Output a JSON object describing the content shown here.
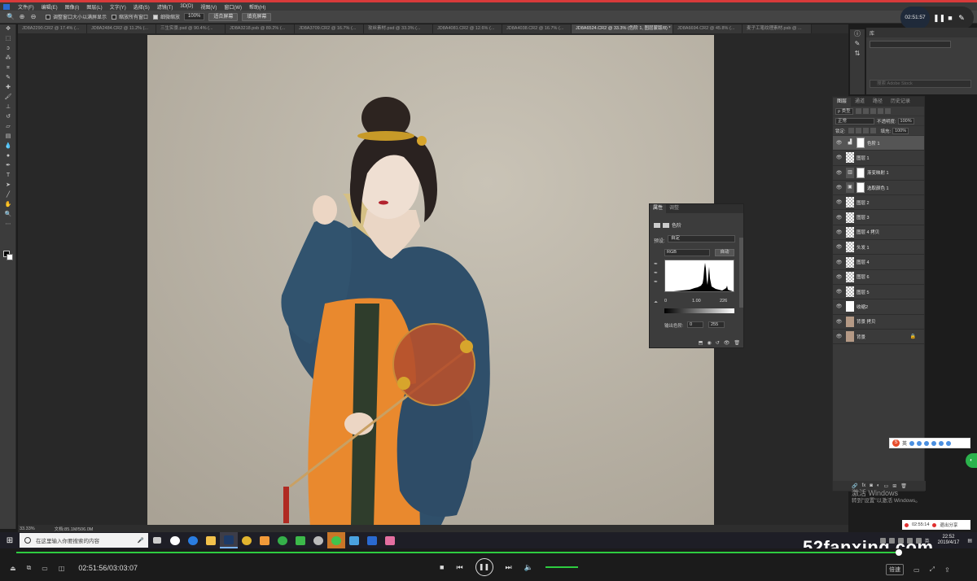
{
  "menubar": {
    "items": [
      "文件(F)",
      "编辑(E)",
      "图像(I)",
      "图层(L)",
      "文字(Y)",
      "选择(S)",
      "滤镜(T)",
      "3D(D)",
      "视图(V)",
      "窗口(W)",
      "帮助(H)"
    ]
  },
  "options": {
    "chk1_label": "调整窗口大小以满屏显示",
    "chk2_label": "缩放所有窗口",
    "chk3_label": "细微缩放",
    "zoom_value": "100%",
    "fit_btn": "适合屏幕",
    "fill_btn": "填充屏幕"
  },
  "tabs": [
    {
      "label": "JD8A2290.CR2 @ 17.4% (..."
    },
    {
      "label": "JD8A2484.CR2 @ 11.2% (..."
    },
    {
      "label": "三生实景.psd @ 90.4% (..."
    },
    {
      "label": "JD8A3218.psb @ 89.2% (..."
    },
    {
      "label": "JD8A3709.CR2 @ 16.7% (..."
    },
    {
      "label": "玫丝素材.psd @ 33.3% (..."
    },
    {
      "label": "JD8A4081.CR2 @ 12.6% (..."
    },
    {
      "label": "JD8A4038.CR2 @ 16.7% (..."
    },
    {
      "label": "JD8A6524.CR2 @ 33.3% (色阶 1, 图层蒙版/8) *"
    },
    {
      "label": "JD8A6694.CR2 @ 45.8% (..."
    },
    {
      "label": "麦子工笔纹理素材.psb @ ..."
    }
  ],
  "status": {
    "zoom": "33.33%",
    "doc": "文档:85.1M/506.0M"
  },
  "recorder": {
    "time": "02:51:57"
  },
  "library": {
    "tab": "库",
    "search_placeholder": "搜索 Adobe Stock"
  },
  "layers_panel": {
    "tabs": [
      "图层",
      "通道",
      "路径",
      "历史记录"
    ],
    "kind": "ρ 类型",
    "blend": "正常",
    "opacity_label": "不透明度:",
    "opacity": "100%",
    "lock_label": "锁定:",
    "fill_label": "填充:",
    "fill": "100%",
    "layers": [
      {
        "name": "色阶 1",
        "thumb": "levels"
      },
      {
        "name": "图层 1",
        "thumb": "transparent"
      },
      {
        "name": "渐变映射 1",
        "thumb": "gradient"
      },
      {
        "name": "选取颜色 1",
        "thumb": "selective"
      },
      {
        "name": "图层 2",
        "thumb": "transparent"
      },
      {
        "name": "图层 3",
        "thumb": "transparent"
      },
      {
        "name": "图层 4 拷贝",
        "thumb": "transparent"
      },
      {
        "name": "头发 1",
        "thumb": "transparent"
      },
      {
        "name": "图层 4",
        "thumb": "transparent"
      },
      {
        "name": "图层 6",
        "thumb": "transparent"
      },
      {
        "name": "图层 5",
        "thumb": "transparent"
      },
      {
        "name": "收缩2",
        "thumb": "white"
      },
      {
        "name": "背景 拷贝",
        "thumb": "photo"
      },
      {
        "name": "背景",
        "thumb": "photo"
      }
    ]
  },
  "properties": {
    "tabs": [
      "属性",
      "调整"
    ],
    "title": "色阶",
    "preset_label": "预设:",
    "preset_value": "自定",
    "channel": "RGB",
    "auto_btn": "自动",
    "input_black": "0",
    "input_gamma": "1.00",
    "input_white": "226",
    "output_label": "输出色阶:",
    "output_black": "0",
    "output_white": "255"
  },
  "ime": {
    "lang": "英"
  },
  "activate": {
    "line1": "激活 Windows",
    "line2": "转到\"设置\"以激活 Windows。"
  },
  "recpop": {
    "time": "02:55:14",
    "exit": "退出分享"
  },
  "taskbar": {
    "search_placeholder": "在这里输入你要搜索的内容",
    "time": "22:52",
    "date": "2019/4/17",
    "ime": "英"
  },
  "player": {
    "time": "02:51:56/03:03:07",
    "speed": "倍速",
    "progress": 0.9348
  },
  "watermark": "52fanxing.com"
}
